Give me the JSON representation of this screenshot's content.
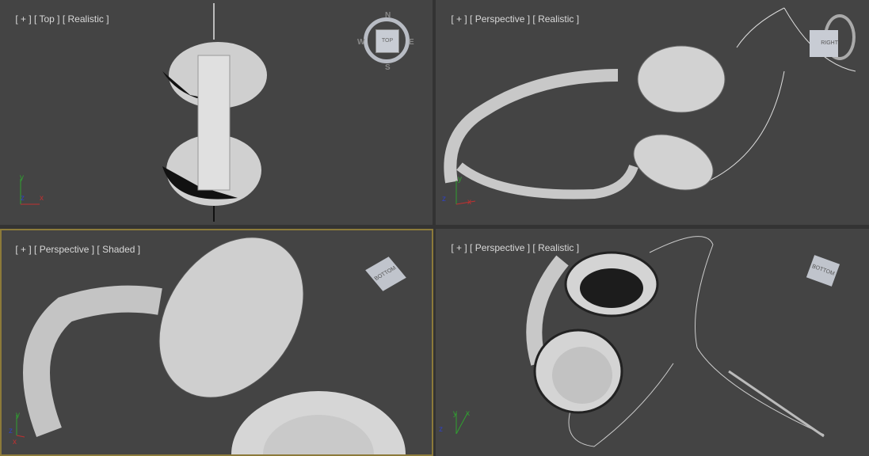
{
  "viewports": [
    {
      "menu": "[ + ]",
      "view": "[ Top ]",
      "shading": "[ Realistic ]",
      "gizmo": "viewcube-compass",
      "cube_face": "TOP",
      "compass": {
        "n": "N",
        "s": "S",
        "e": "E",
        "w": "W"
      },
      "active": false
    },
    {
      "menu": "[ + ]",
      "view": "[ Perspective ]",
      "shading": "[ Realistic ]",
      "gizmo": "viewcube",
      "cube_face": "RIGHT",
      "active": false
    },
    {
      "menu": "[ + ]",
      "view": "[ Perspective ]",
      "shading": "[ Shaded ]",
      "gizmo": "viewcube",
      "cube_face": "BOTTOM",
      "active": true
    },
    {
      "menu": "[ + ]",
      "view": "[ Perspective ]",
      "shading": "[ Realistic ]",
      "gizmo": "viewcube",
      "cube_face": "BOTTOM",
      "active": false
    }
  ],
  "axes": {
    "x": "x",
    "y": "y",
    "z": "z"
  },
  "colors": {
    "viewport_bg": "#444444",
    "active_border": "#8c7a3a",
    "axis_x": "#c03030",
    "axis_y": "#30a030",
    "axis_z": "#3040c0"
  }
}
